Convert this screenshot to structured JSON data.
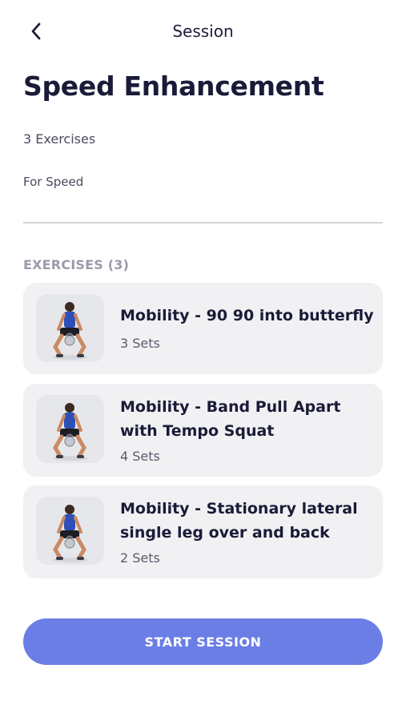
{
  "header": {
    "back_icon": "chevron-left-icon",
    "title": "Session"
  },
  "session": {
    "name": "Speed Enhancement",
    "exercise_count_label": "3 Exercises",
    "focus": "For Speed"
  },
  "exercises_section": {
    "label": "EXERCISES (3)",
    "items": [
      {
        "name": "Mobility - 90 90 into butterfly",
        "sets": "3 Sets",
        "thumbnail_icon": "kettlebell-athlete-image"
      },
      {
        "name": "Mobility - Band Pull Apart with Tempo Squat",
        "sets": "4 Sets",
        "thumbnail_icon": "kettlebell-athlete-image"
      },
      {
        "name": "Mobility - Stationary lateral single leg over and back",
        "sets": "2 Sets",
        "thumbnail_icon": "kettlebell-athlete-image"
      }
    ]
  },
  "actions": {
    "start_label": "START SESSION"
  },
  "colors": {
    "accent": "#6a7ee6",
    "card_bg": "#f1f1f3",
    "text_primary": "#1a1b38",
    "text_muted": "#9a9baa"
  }
}
